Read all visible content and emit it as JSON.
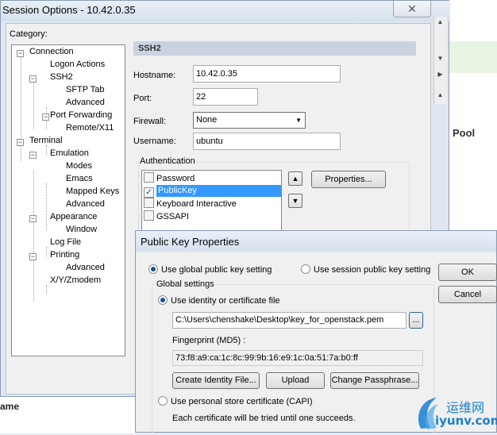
{
  "session_window": {
    "title": "Session Options - 10.42.0.35",
    "close_glyph": "✕",
    "category_label": "Category:",
    "tree": [
      {
        "label": "Connection",
        "expander": "−"
      },
      {
        "label": "Logon Actions"
      },
      {
        "label": "SSH2",
        "expander": "−"
      },
      {
        "label": "SFTP Tab"
      },
      {
        "label": "Advanced"
      },
      {
        "label": "Port Forwarding",
        "expander": "−"
      },
      {
        "label": "Remote/X11"
      },
      {
        "label": "Terminal",
        "expander": "−"
      },
      {
        "label": "Emulation",
        "expander": "−"
      },
      {
        "label": "Modes"
      },
      {
        "label": "Emacs"
      },
      {
        "label": "Mapped Keys"
      },
      {
        "label": "Advanced"
      },
      {
        "label": "Appearance",
        "expander": "−"
      },
      {
        "label": "Window"
      },
      {
        "label": "Log File"
      },
      {
        "label": "Printing",
        "expander": "−"
      },
      {
        "label": "Advanced"
      },
      {
        "label": "X/Y/Zmodem"
      }
    ],
    "section_header": "SSH2",
    "hostname_label": "Hostname:",
    "hostname_value": "10.42.0.35",
    "port_label": "Port:",
    "port_value": "22",
    "firewall_label": "Firewall:",
    "firewall_value": "None",
    "username_label": "Username:",
    "username_value": "ubuntu",
    "auth_group": "Authentication",
    "auth_methods": [
      {
        "label": "Password",
        "checked": false
      },
      {
        "label": "PublicKey",
        "checked": true
      },
      {
        "label": "Keyboard Interactive",
        "checked": false
      },
      {
        "label": "GSSAPI",
        "checked": false
      }
    ],
    "properties_button": "Properties..."
  },
  "background": {
    "pool_label": "Pool",
    "name_fragment": "ame"
  },
  "dialog": {
    "title": "Public Key Properties",
    "use_global": "Use global public key setting",
    "use_session": "Use session public key setting",
    "ok": "OK",
    "cancel": "Cancel",
    "global_settings": "Global settings",
    "use_identity": "Use identity or certificate file",
    "identity_path": "C:\\Users\\chenshake\\Desktop\\key_for_openstack.pem",
    "browse": "...",
    "fingerprint_label": "Fingerprint (MD5) :",
    "fingerprint_value": "73:f8:a9:ca:1c:8c:99:9b:16:e9:1c:0a:51:7a:b0:ff",
    "create_identity": "Create Identity File...",
    "upload": "Upload",
    "change_passphrase": "Change Passphrase...",
    "use_personal_store": "Use personal store certificate (CAPI)",
    "note": "Each certificate will be tried until one succeeds."
  },
  "watermark": {
    "cn": "运维网",
    "url": "iyunv.com"
  },
  "colors": {
    "accent": "#3399ff",
    "title_bg": "#dfe7f1",
    "watermark_blue": "#1a7fd0"
  }
}
